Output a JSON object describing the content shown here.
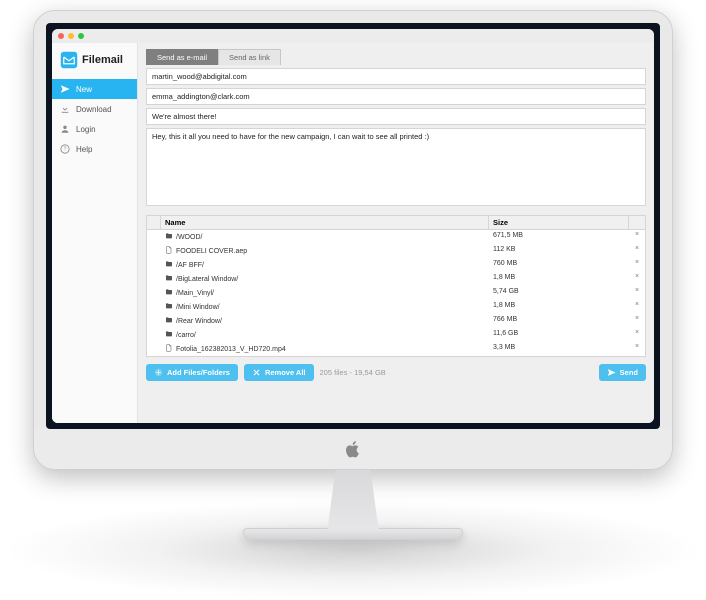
{
  "brand": {
    "name": "Filemail"
  },
  "sidebar": {
    "items": [
      {
        "label": "New",
        "icon": "paper-plane-icon",
        "active": true
      },
      {
        "label": "Download",
        "icon": "download-icon",
        "active": false
      },
      {
        "label": "Login",
        "icon": "user-icon",
        "active": false
      },
      {
        "label": "Help",
        "icon": "help-icon",
        "active": false
      }
    ]
  },
  "tabs": [
    {
      "label": "Send as e-mail",
      "active": true
    },
    {
      "label": "Send as link",
      "active": false
    }
  ],
  "form": {
    "to": "martin_wood@abdigital.com",
    "from": "emma_addington@clark.com",
    "subject": "We're almost there!",
    "message": "Hey, this it all you need to have for the new campaign, I can wait to see all printed :)"
  },
  "table": {
    "headers": {
      "name": "Name",
      "size": "Size"
    },
    "rows": [
      {
        "type": "folder",
        "name": "/WOOD/",
        "size": "671,5 MB"
      },
      {
        "type": "file",
        "name": "FOODELI COVER.aep",
        "size": "112 KB"
      },
      {
        "type": "folder",
        "name": "/AF BFF/",
        "size": "760 MB"
      },
      {
        "type": "folder",
        "name": "/BigLateral Window/",
        "size": "1,8 MB"
      },
      {
        "type": "folder",
        "name": "/Main_Vinyl/",
        "size": "5,74 GB"
      },
      {
        "type": "folder",
        "name": "/Mini Window/",
        "size": "1,8 MB"
      },
      {
        "type": "folder",
        "name": "/Rear Window/",
        "size": "766 MB"
      },
      {
        "type": "folder",
        "name": "/carro/",
        "size": "11,6 GB"
      },
      {
        "type": "file",
        "name": "Fotolia_162382013_V_HD720.mp4",
        "size": "3,3 MB"
      }
    ]
  },
  "footer": {
    "add_label": "Add Files/Folders",
    "remove_label": "Remove All",
    "summary": "205 files - 19,54 GB",
    "send_label": "Send"
  }
}
